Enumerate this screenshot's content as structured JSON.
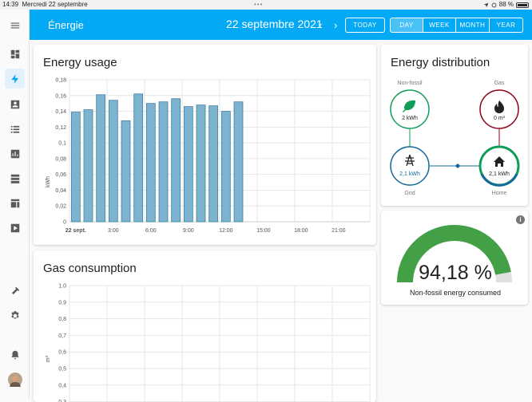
{
  "status": {
    "time": "14:39",
    "date": "Mercredi 22 septembre",
    "dots": "•••",
    "battery": "88 %"
  },
  "header": {
    "title": "Énergie",
    "date": "22 septembre 2021",
    "prev": "‹",
    "next": "›",
    "today": "TODAY",
    "periods": [
      "DAY",
      "WEEK",
      "MONTH",
      "YEAR"
    ],
    "active_period": "DAY"
  },
  "colors": {
    "accent": "#03a9f4",
    "bar": "#7eb3d0",
    "bar_stroke": "#3f7fa5",
    "solar": "#0f9d58",
    "gas": "#8e021b",
    "grid": "#126a9a",
    "gauge": "#43a047"
  },
  "energy_usage": {
    "title": "Energy usage"
  },
  "gas_consumption": {
    "title": "Gas consumption"
  },
  "distribution": {
    "title": "Energy distribution",
    "nonfossil": {
      "label": "Non-fossil",
      "value": "2 kWh",
      "icon": "leaf-icon"
    },
    "gas": {
      "label": "Gas",
      "value": "0 m³",
      "icon": "fire-icon"
    },
    "grid": {
      "label": "Grid",
      "value": "2,1 kWh",
      "icon": "transmission-tower-icon"
    },
    "home": {
      "label": "Home",
      "value": "2,1 kWh",
      "icon": "home-icon"
    }
  },
  "gauge": {
    "value": "94,18 %",
    "fraction": 0.9418,
    "caption": "Non-fossil energy consumed",
    "info": "i"
  },
  "chart_data": [
    {
      "type": "bar",
      "title": "Energy usage",
      "ylabel": "kWh",
      "ylim": [
        0,
        0.18
      ],
      "yticks": [
        "0",
        "0,02",
        "0,04",
        "0,06",
        "0,08",
        "0,1",
        "0,12",
        "0,14",
        "0,16",
        "0,18"
      ],
      "xticks": [
        "22 sept.",
        "3:00",
        "6:00",
        "9:00",
        "12:00",
        "15:00",
        "18:00",
        "21:00"
      ],
      "hours": [
        0,
        1,
        2,
        3,
        4,
        5,
        6,
        7,
        8,
        9,
        10,
        11,
        12,
        13,
        14
      ],
      "values": [
        0.139,
        0.142,
        0.161,
        0.154,
        0.128,
        0.162,
        0.15,
        0.152,
        0.156,
        0.146,
        0.148,
        0.147,
        0.14,
        0.152
      ],
      "grid": true
    },
    {
      "type": "bar",
      "title": "Gas consumption",
      "ylabel": "m³",
      "ylim": [
        0,
        1
      ],
      "yticks": [
        "0,3",
        "0,4",
        "0,5",
        "0,6",
        "0,7",
        "0,8",
        "0,9",
        "1,0"
      ],
      "values": [],
      "grid": true
    }
  ]
}
